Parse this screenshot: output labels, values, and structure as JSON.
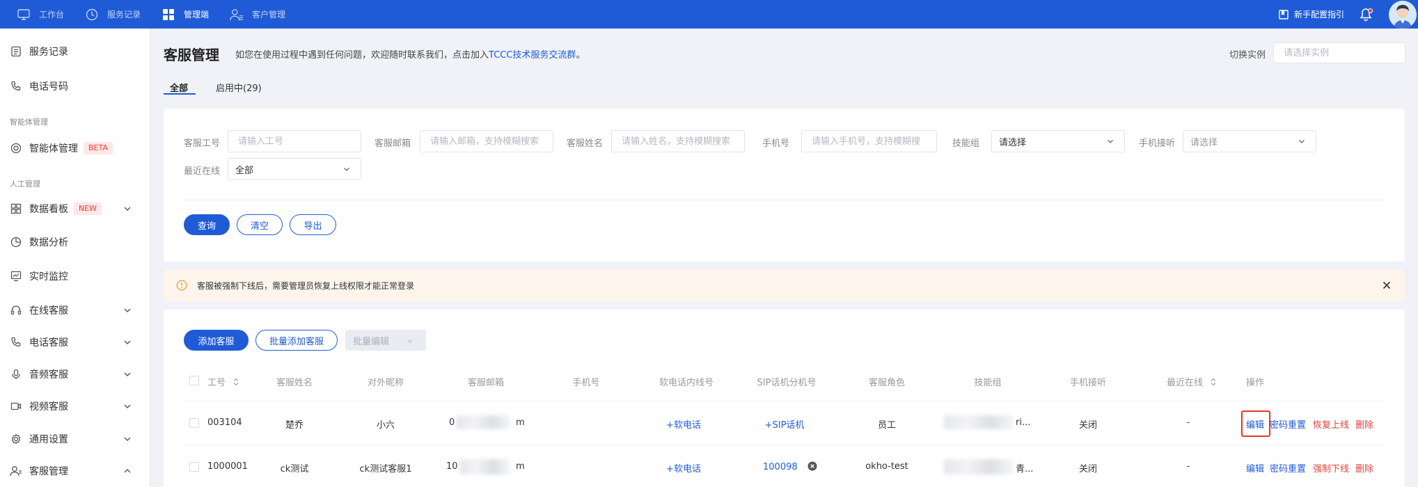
{
  "topbar": {
    "nav": [
      {
        "label": "工作台",
        "icon": "monitor-icon"
      },
      {
        "label": "服务记录",
        "icon": "clock-icon"
      },
      {
        "label": "管理端",
        "icon": "grid-icon",
        "active": true
      },
      {
        "label": "客户管理",
        "icon": "user-group-icon"
      }
    ],
    "guide_label": "新手配置指引"
  },
  "sidebar": {
    "items": [
      {
        "label": "服务记录",
        "icon": "document-icon"
      },
      {
        "label": "电话号码",
        "icon": "phone-icon"
      }
    ],
    "group_ai": "智能体管理",
    "ai_item": {
      "label": "智能体管理",
      "badge": "BETA"
    },
    "group_manual": "人工管理",
    "manual_items": [
      {
        "label": "数据看板",
        "badge": "NEW",
        "expand": "down"
      },
      {
        "label": "数据分析"
      },
      {
        "label": "实时监控"
      },
      {
        "label": "在线客服",
        "expand": "down"
      },
      {
        "label": "电话客服",
        "expand": "down"
      },
      {
        "label": "音频客服",
        "expand": "down"
      },
      {
        "label": "视频客服",
        "expand": "down"
      },
      {
        "label": "通用设置",
        "expand": "down"
      },
      {
        "label": "客服管理",
        "expand": "up"
      }
    ]
  },
  "header": {
    "title": "客服管理",
    "desc_prefix": "如您在使用过程中遇到任何问题，欢迎随时联系我们，点击加入",
    "desc_link": "TCCC技术服务交流群",
    "desc_suffix": "。",
    "switch_label": "切换实例",
    "switch_placeholder": "请选择实例"
  },
  "tabs": [
    {
      "label": "全部",
      "active": true
    },
    {
      "label": "启用中(29)"
    }
  ],
  "filters": {
    "agent_id": {
      "label": "客服工号",
      "placeholder": "请输入工号"
    },
    "email": {
      "label": "客服邮箱",
      "placeholder": "请输入邮箱，支持模糊搜索"
    },
    "name": {
      "label": "客服姓名",
      "placeholder": "请输入姓名，支持模糊搜索"
    },
    "phone": {
      "label": "手机号",
      "placeholder": "请输入手机号，支持模糊搜"
    },
    "skill_group": {
      "label": "技能组",
      "value": "请选择"
    },
    "phone_answer": {
      "label": "手机接听",
      "value": "请选择"
    },
    "last_online": {
      "label": "最近在线",
      "value": "全部"
    },
    "buttons": {
      "query": "查询",
      "clear": "清空",
      "export": "导出"
    }
  },
  "alert": {
    "text": "客服被强制下线后，需要管理员恢复上线权限才能正常登录"
  },
  "table": {
    "toolbar": {
      "add": "添加客服",
      "batch_add": "批量添加客服",
      "batch_edit": "批量编辑"
    },
    "columns": [
      "工号",
      "客服姓名",
      "对外昵称",
      "客服邮箱",
      "手机号",
      "软电话内线号",
      "SIP话机分机号",
      "客服角色",
      "技能组",
      "手机接听",
      "最近在线",
      "操作"
    ],
    "rows": [
      {
        "id": "003104",
        "name": "楚乔",
        "nickname": "小六",
        "email_start": "0",
        "email_end": "m",
        "phone": "",
        "softphone": "+软电话",
        "sip": "+SIP话机",
        "role": "员工",
        "skill_tail": "ri...",
        "answer": "关闭",
        "online": "-",
        "actions": [
          {
            "label": "编辑",
            "color": "blue"
          },
          {
            "label": "密码重置",
            "color": "blue"
          },
          {
            "label": "恢复上线",
            "color": "red"
          },
          {
            "label": "删除",
            "color": "red"
          }
        ]
      },
      {
        "id": "1000001",
        "name": "ck测试",
        "nickname": "ck测试客服1",
        "email_start": "10",
        "email_end": "m",
        "phone": "",
        "softphone": "+软电话",
        "sip": "100098",
        "role": "okho-test",
        "skill_tail": "青...",
        "answer": "关闭",
        "online": "-",
        "actions": [
          {
            "label": "编辑",
            "color": "blue"
          },
          {
            "label": "密码重置",
            "color": "blue"
          },
          {
            "label": "强制下线",
            "color": "red"
          },
          {
            "label": "删除",
            "color": "red"
          }
        ]
      }
    ]
  },
  "colors": {
    "primary": "#1f5bd6",
    "danger": "#e0403a",
    "alert_bg": "#fdf4ec",
    "alert_icon": "#f2a33a"
  }
}
